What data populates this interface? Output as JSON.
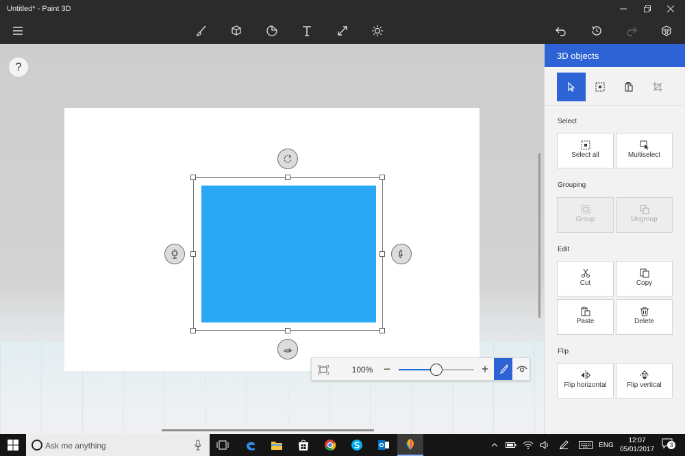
{
  "window": {
    "title": "Untitled* - Paint 3D"
  },
  "help": {
    "label": "?"
  },
  "panel": {
    "title": "3D objects",
    "sections": {
      "select": "Select",
      "grouping": "Grouping",
      "edit": "Edit",
      "flip": "Flip"
    },
    "buttons": {
      "select_all": "Select all",
      "multiselect": "Multiselect",
      "group": "Group",
      "ungroup": "Ungroup",
      "cut": "Cut",
      "copy": "Copy",
      "paste": "Paste",
      "delete": "Delete",
      "flip_horizontal": "Flip horizontal",
      "flip_vertical": "Flip vertical"
    }
  },
  "zoom": {
    "percent": "100%",
    "minus": "−",
    "plus": "+",
    "level": 0.5
  },
  "taskbar": {
    "search_placeholder": "Ask me anything",
    "language": "ENG",
    "time": "12:07",
    "date": "05/01/2017",
    "notification_count": "3"
  },
  "colors": {
    "accent": "#2e63d5",
    "shape_fill": "#2aa8f5",
    "chrome": "#2b2b2b"
  }
}
